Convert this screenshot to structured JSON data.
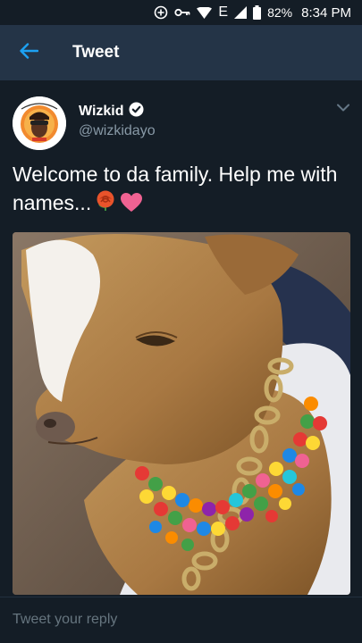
{
  "status_bar": {
    "network": "E",
    "battery": "82%",
    "time": "8:34 PM"
  },
  "app_bar": {
    "title": "Tweet"
  },
  "tweet": {
    "display_name": "Wizkid",
    "handle": "@wizkidayo",
    "text": "Welcome to da family. Help me with names...",
    "emojis": [
      "rose-emoji",
      "pink-heart-emoji"
    ]
  },
  "reply": {
    "placeholder": "Tweet your reply"
  },
  "colors": {
    "background": "#141d26",
    "header": "#243447",
    "accent": "#1da1f2",
    "muted": "#8899a6"
  }
}
